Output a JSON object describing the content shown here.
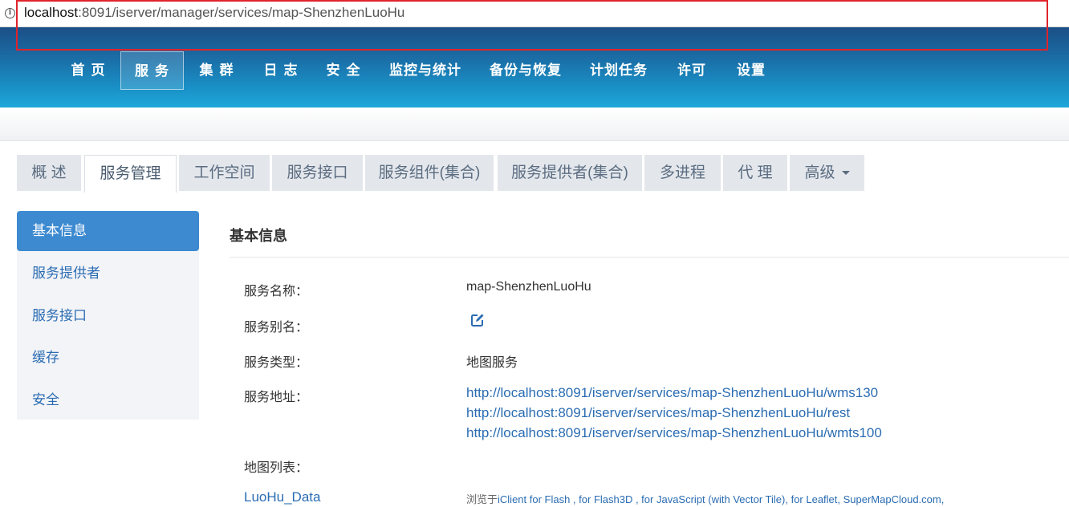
{
  "address_bar": {
    "url_host": "localhost",
    "url_rest": ":8091/iserver/manager/services/map-ShenzhenLuoHu"
  },
  "top_nav": {
    "items": [
      "首 页",
      "服 务",
      "集 群",
      "日 志",
      "安 全",
      "监控与统计",
      "备份与恢复",
      "计划任务",
      "许可",
      "设置"
    ],
    "active": "服 务"
  },
  "tabs": {
    "items": [
      "概 述",
      "服务管理",
      "工作空间",
      "服务接口",
      "服务组件(集合)",
      "服务提供者(集合)",
      "多进程",
      "代 理",
      "高级"
    ],
    "active": "服务管理"
  },
  "sidebar": {
    "items": [
      "基本信息",
      "服务提供者",
      "服务接口",
      "缓存",
      "安全"
    ],
    "active": "基本信息"
  },
  "main": {
    "section_title": "基本信息",
    "fields": {
      "name_label": "服务名称：",
      "name_value": "map-ShenzhenLuoHu",
      "alias_label": "服务别名：",
      "type_label": "服务类型：",
      "type_value": "地图服务",
      "address_label": "服务地址：",
      "addresses": [
        "http://localhost:8091/iserver/services/map-ShenzhenLuoHu/wms130",
        "http://localhost:8091/iserver/services/map-ShenzhenLuoHu/rest",
        "http://localhost:8091/iserver/services/map-ShenzhenLuoHu/wmts100"
      ],
      "map_list_label": "地图列表：",
      "map_name": "LuoHu_Data",
      "browse_prefix": "浏览于",
      "browse_links": "iClient for Flash , for Flash3D , for JavaScript (with Vector Tile), for Leaflet, SuperMapCloud.com,"
    }
  },
  "colors": {
    "nav_gradient_top": "#1b4f86",
    "nav_gradient_bottom": "#1fa7d9",
    "sidebar_active": "#3d8ad0",
    "link": "#2a6cb2",
    "highlight_box": "#e0232b"
  }
}
